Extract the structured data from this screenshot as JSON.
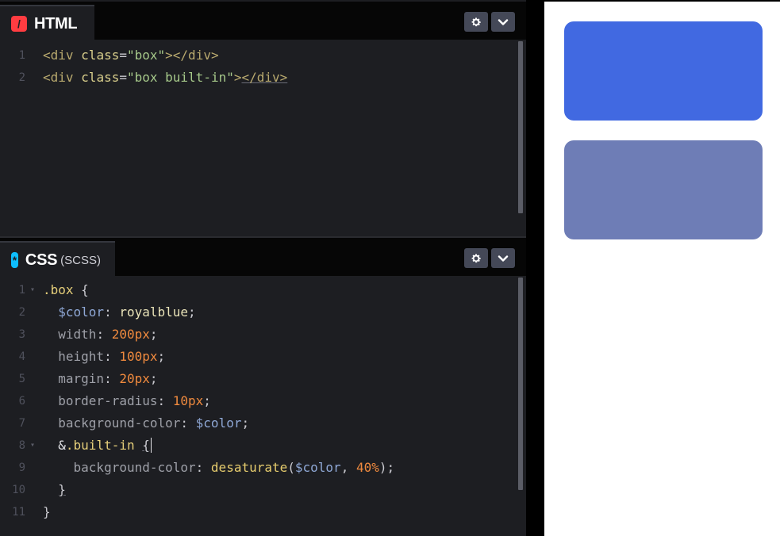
{
  "html_editor": {
    "title": "HTML",
    "icon": "html-slash-icon",
    "icon_glyph": "/",
    "lines": [
      {
        "n": "1",
        "parts": [
          [
            "t-tag",
            "<div "
          ],
          [
            "t-attr",
            "class"
          ],
          [
            "t-punc",
            "="
          ],
          [
            "t-str",
            "\"box\""
          ],
          [
            "t-tag",
            "></div>"
          ]
        ]
      },
      {
        "n": "2",
        "parts": [
          [
            "t-tag",
            "<div "
          ],
          [
            "t-attr",
            "class"
          ],
          [
            "t-punc",
            "="
          ],
          [
            "t-str",
            "\"box built-in\""
          ],
          [
            "t-tag",
            ">"
          ],
          [
            "t-tag underline",
            "</div>"
          ]
        ]
      }
    ]
  },
  "css_editor": {
    "title": "CSS",
    "subtitle": "(SCSS)",
    "icon": "css-asterisk-icon",
    "icon_glyph": "*",
    "lines": [
      {
        "n": "1",
        "fold": true,
        "parts": [
          [
            "t-sel",
            ".box "
          ],
          [
            "t-punc",
            "{"
          ]
        ]
      },
      {
        "n": "2",
        "parts": [
          [
            "t-plain",
            "  "
          ],
          [
            "t-var",
            "$color"
          ],
          [
            "t-punc",
            ": "
          ],
          [
            "t-val",
            "royalblue"
          ],
          [
            "t-punc",
            ";"
          ]
        ]
      },
      {
        "n": "3",
        "parts": [
          [
            "t-plain",
            "  "
          ],
          [
            "t-prop",
            "width"
          ],
          [
            "t-punc",
            ": "
          ],
          [
            "t-num",
            "200px"
          ],
          [
            "t-punc",
            ";"
          ]
        ]
      },
      {
        "n": "4",
        "parts": [
          [
            "t-plain",
            "  "
          ],
          [
            "t-prop",
            "height"
          ],
          [
            "t-punc",
            ": "
          ],
          [
            "t-num",
            "100px"
          ],
          [
            "t-punc",
            ";"
          ]
        ]
      },
      {
        "n": "5",
        "parts": [
          [
            "t-plain",
            "  "
          ],
          [
            "t-prop",
            "margin"
          ],
          [
            "t-punc",
            ": "
          ],
          [
            "t-num",
            "20px"
          ],
          [
            "t-punc",
            ";"
          ]
        ]
      },
      {
        "n": "6",
        "parts": [
          [
            "t-plain",
            "  "
          ],
          [
            "t-prop",
            "border-radius"
          ],
          [
            "t-punc",
            ": "
          ],
          [
            "t-num",
            "10px"
          ],
          [
            "t-punc",
            ";"
          ]
        ]
      },
      {
        "n": "7",
        "parts": [
          [
            "t-plain",
            "  "
          ],
          [
            "t-prop",
            "background-color"
          ],
          [
            "t-punc",
            ": "
          ],
          [
            "t-var",
            "$color"
          ],
          [
            "t-punc",
            ";"
          ]
        ]
      },
      {
        "n": "8",
        "fold": true,
        "parts": [
          [
            "t-plain",
            "  &"
          ],
          [
            "t-sel",
            ".built-in "
          ],
          [
            "t-punc underline",
            "{"
          ],
          [
            "cursor",
            ""
          ]
        ]
      },
      {
        "n": "9",
        "parts": [
          [
            "t-plain",
            "    "
          ],
          [
            "t-prop",
            "background-color"
          ],
          [
            "t-punc",
            ": "
          ],
          [
            "t-fn",
            "desaturate"
          ],
          [
            "t-punc",
            "("
          ],
          [
            "t-var",
            "$color"
          ],
          [
            "t-punc",
            ", "
          ],
          [
            "t-num",
            "40%"
          ],
          [
            "t-punc",
            ");"
          ]
        ]
      },
      {
        "n": "10",
        "parts": [
          [
            "t-plain",
            "  "
          ],
          [
            "t-punc underline",
            "}"
          ]
        ]
      },
      {
        "n": "11",
        "parts": [
          [
            "t-punc",
            "}"
          ]
        ]
      }
    ]
  },
  "preview": {
    "boxes": [
      {
        "name": "box",
        "color": "#4169e1"
      },
      {
        "name": "box built-in",
        "color": "#6e7db6"
      }
    ]
  },
  "icons": {
    "settings": "gear-icon",
    "collapse": "chevron-down-icon"
  }
}
